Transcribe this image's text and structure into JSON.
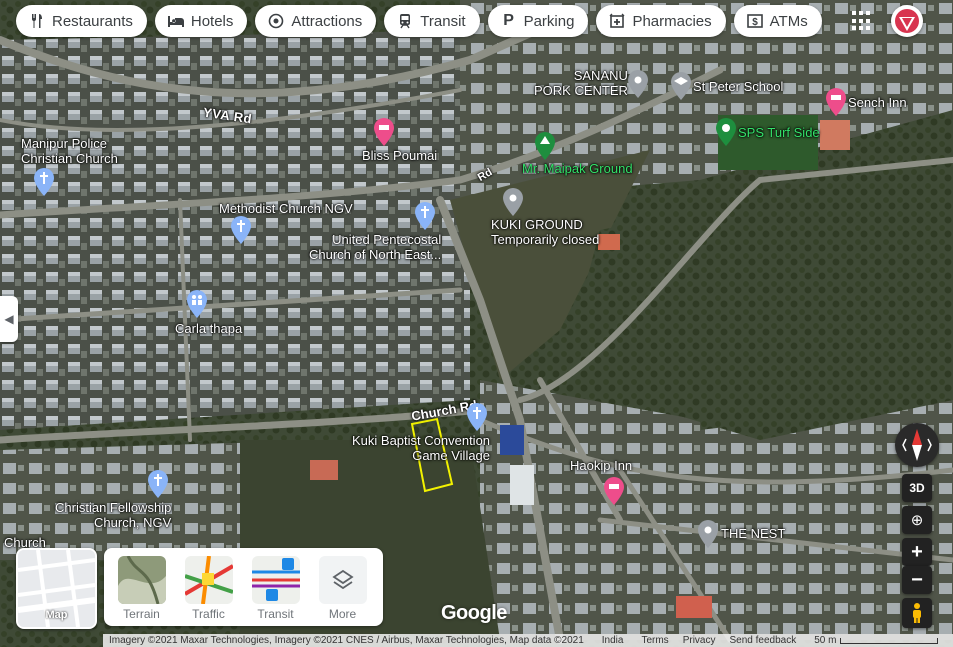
{
  "chips": [
    {
      "label": "Restaurants",
      "icon": "fork-knife-icon"
    },
    {
      "label": "Hotels",
      "icon": "bed-icon"
    },
    {
      "label": "Attractions",
      "icon": "camera-icon"
    },
    {
      "label": "Transit",
      "icon": "train-icon"
    },
    {
      "label": "Parking",
      "icon": "parking-icon"
    },
    {
      "label": "Pharmacies",
      "icon": "pharmacy-icon"
    },
    {
      "label": "ATMs",
      "icon": "atm-icon"
    }
  ],
  "roads": {
    "yva": "YVA Rd",
    "church": "Church Rd",
    "top_right": "Rd"
  },
  "places": {
    "manipur_police_1": "Manipur Police",
    "manipur_police_2": "Christian Church",
    "bliss": "Bliss Poumai",
    "sananu_1": "SANANU",
    "sananu_2": "PORK CENTER",
    "st_peter": "St Peter School",
    "sench": "Sench Inn",
    "sps": "SPS Turf Side",
    "maipak": "Mr. Maipak Ground",
    "methodist": "Methodist Church NGV",
    "kuki_ground": "KUKI GROUND",
    "kuki_ground_status": "Temporarily closed",
    "upc_1": "United Pentecostal",
    "upc_2": "Church of North East...",
    "carla": "Carla thapa",
    "kbc_1": "Kuki Baptist Convention",
    "kbc_2": "Game Village",
    "haokip": "Haokip Inn",
    "cfc_1": "Christian Fellowship",
    "cfc_2": "Church, NGV",
    "the_nest": "THE NEST",
    "church": "Church"
  },
  "minimap": {
    "label": "Map"
  },
  "layers": [
    {
      "label": "Terrain"
    },
    {
      "label": "Traffic"
    },
    {
      "label": "Transit"
    },
    {
      "label": "More"
    }
  ],
  "controls": {
    "three_d": "3D",
    "zoom_in": "+",
    "zoom_out": "−"
  },
  "brand": "Google",
  "footer": {
    "imagery": "Imagery ©2021 Maxar Technologies, Imagery ©2021 CNES / Airbus, Maxar Technologies, Map data ©2021",
    "country": "India",
    "terms": "Terms",
    "privacy": "Privacy",
    "feedback": "Send feedback",
    "scale": "50 m"
  },
  "colors": {
    "aerial_base": "#3a3f33",
    "highlight_plot": "#f2f200",
    "pin_blue": "#8ab4f8",
    "pin_pink": "#ee4d8b",
    "pin_green": "#1e8e3e",
    "pin_gray": "#9aa0a6"
  }
}
